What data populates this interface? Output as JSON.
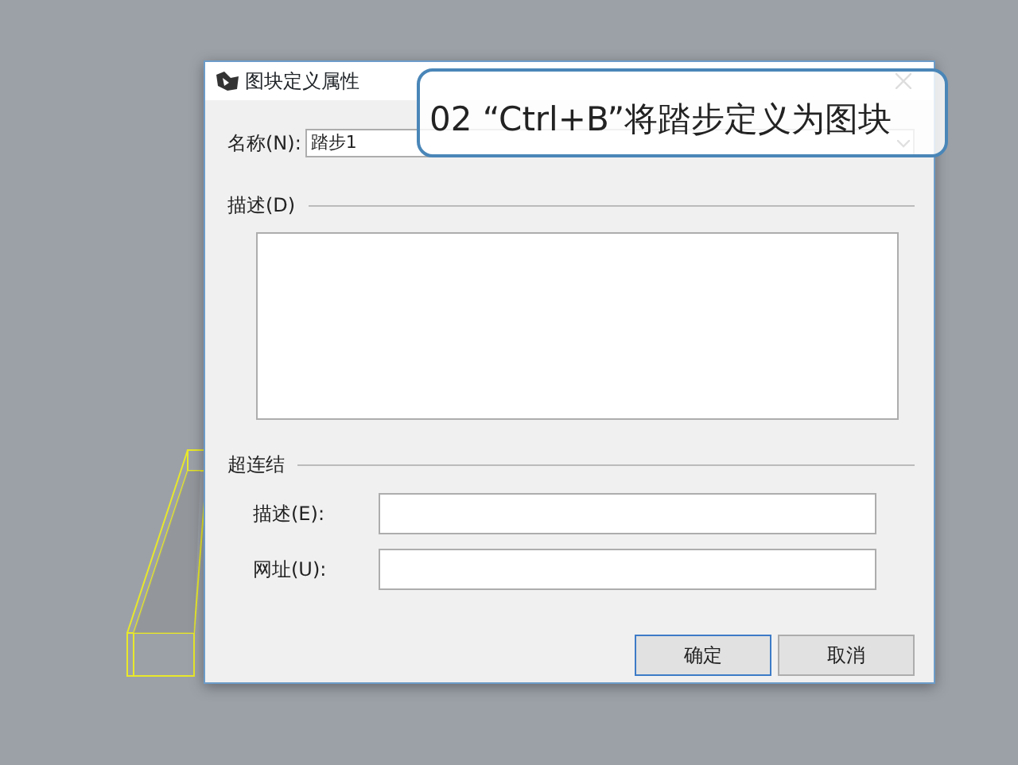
{
  "dialog": {
    "title": "图块定义属性",
    "name_label": "名称(N):",
    "name_value": "踏步1",
    "description_section": "描述(D)",
    "hyperlink_section": "超连结",
    "fields": [
      {
        "label": "描述(E):"
      },
      {
        "label": "网址(U):"
      }
    ],
    "buttons": [
      {
        "label": "确定",
        "default": true
      },
      {
        "label": "取消",
        "default": false
      }
    ]
  },
  "callout": {
    "text": "02 “Ctrl+B”将踏步定义为图块"
  }
}
